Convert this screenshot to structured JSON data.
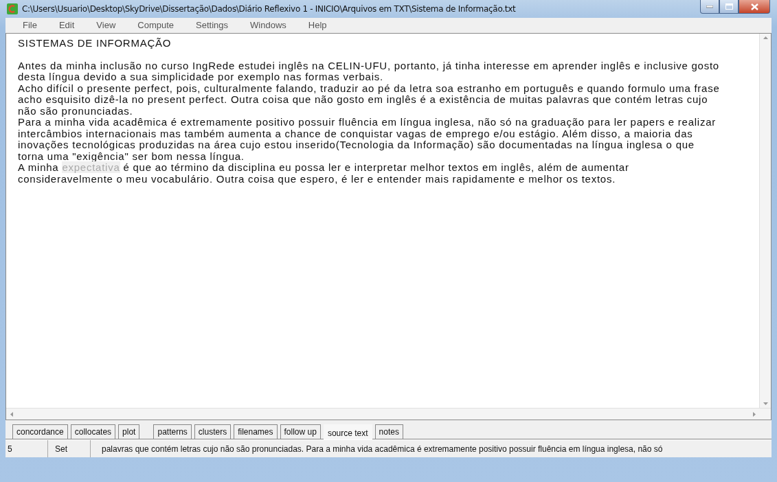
{
  "window": {
    "title": "C:\\Users\\Usuario\\Desktop\\SkyDrive\\Dissertação\\Dados\\Diário Reflexivo 1 - INICIO\\Arquivos em TXT\\Sistema de Informação.txt"
  },
  "menu": [
    "File",
    "Edit",
    "View",
    "Compute",
    "Settings",
    "Windows",
    "Help"
  ],
  "document": {
    "heading": "SISTEMAS DE INFORMAÇÃO",
    "lines": [
      {
        "text": "Antes da minha inclusão no curso IngRede estudei inglês na CELIN-UFU, portanto, já tinha interesse em aprender inglês e inclusive gosto"
      },
      {
        "text": "desta língua devido a sua simplicidade por exemplo nas formas verbais."
      },
      {
        "text": "Acho difícil o presente perfect, pois, culturalmente falando, traduzir ao pé da letra soa estranho em português e quando formulo uma frase"
      },
      {
        "text": "acho esquisito dizê-la no present perfect. Outra coisa que não gosto em inglês é a existência de muitas palavras que contém letras cujo"
      },
      {
        "text": "não são pronunciadas."
      },
      {
        "text": "Para a minha vida acadêmica é extremamente positivo possuir fluência em língua inglesa, não só na graduação para ler papers e realizar"
      },
      {
        "text": "intercâmbios internacionais mas também aumenta a chance de conquistar vagas de emprego e/ou estágio. Além disso, a maioria das"
      },
      {
        "text": "inovações tecnológicas produzidas na área cujo estou inserido(Tecnologia da Informação) são documentadas na língua inglesa o que"
      },
      {
        "text": "torna uma \"exigência\" ser bom nessa língua."
      },
      {
        "text": "A minha ",
        "highlight": "expectativa",
        "after": " é que ao término da disciplina eu possa ler e interpretar melhor textos em inglês, além de aumentar"
      },
      {
        "text": "consideravelmente o meu vocabulário. Outra coisa que espero, é ler e entender mais rapidamente e melhor os textos."
      }
    ]
  },
  "tabs": [
    {
      "label": "concordance",
      "selected": false
    },
    {
      "label": "collocates",
      "selected": false
    },
    {
      "label": "plot",
      "selected": false
    },
    {
      "label": "patterns",
      "selected": false
    },
    {
      "label": "clusters",
      "selected": false
    },
    {
      "label": "filenames",
      "selected": false
    },
    {
      "label": "follow up",
      "selected": false
    },
    {
      "label": "source text",
      "selected": true
    },
    {
      "label": "notes",
      "selected": false
    }
  ],
  "status_bar": {
    "column_1": "5",
    "column_2": "Set",
    "column_3": "palavras que contém letras cujo não são pronunciadas. Para a minha vida acadêmica é extremamente positivo possuir fluência em língua inglesa, não só"
  }
}
